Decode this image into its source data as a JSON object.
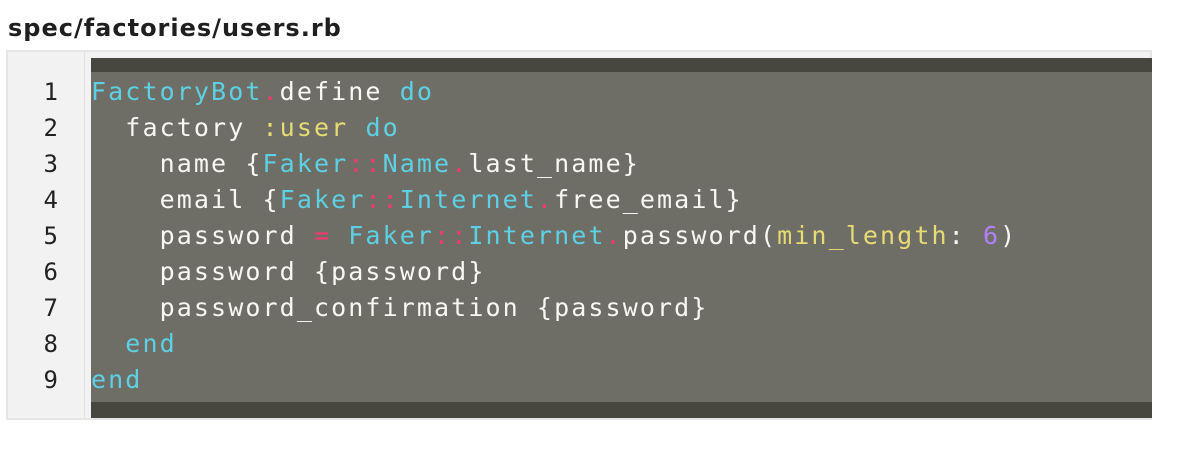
{
  "file_title": "spec/factories/users.rb",
  "line_numbers": [
    "1",
    "2",
    "3",
    "4",
    "5",
    "6",
    "7",
    "8",
    "9"
  ],
  "colors": {
    "keyword": "#5dd1e3",
    "operator": "#f2386f",
    "symbol": "#e6db74",
    "number": "#ae81ff",
    "text": "#f8f8f2",
    "code_background": "#6f6e66"
  },
  "code_lines": [
    [
      {
        "text": "FactoryBot",
        "type": "const"
      },
      {
        "text": ".",
        "type": "op"
      },
      {
        "text": "define ",
        "type": "plain"
      },
      {
        "text": "do",
        "type": "kw"
      }
    ],
    [
      {
        "text": "  factory ",
        "type": "plain"
      },
      {
        "text": ":user ",
        "type": "sym"
      },
      {
        "text": "do",
        "type": "kw"
      }
    ],
    [
      {
        "text": "    name {",
        "type": "plain"
      },
      {
        "text": "Faker",
        "type": "const"
      },
      {
        "text": "::",
        "type": "op"
      },
      {
        "text": "Name",
        "type": "const"
      },
      {
        "text": ".",
        "type": "op"
      },
      {
        "text": "last_name}",
        "type": "plain"
      }
    ],
    [
      {
        "text": "    email {",
        "type": "plain"
      },
      {
        "text": "Faker",
        "type": "const"
      },
      {
        "text": "::",
        "type": "op"
      },
      {
        "text": "Internet",
        "type": "const"
      },
      {
        "text": ".",
        "type": "op"
      },
      {
        "text": "free_email}",
        "type": "plain"
      }
    ],
    [
      {
        "text": "    password ",
        "type": "plain"
      },
      {
        "text": "=",
        "type": "op"
      },
      {
        "text": " ",
        "type": "plain"
      },
      {
        "text": "Faker",
        "type": "const"
      },
      {
        "text": "::",
        "type": "op"
      },
      {
        "text": "Internet",
        "type": "const"
      },
      {
        "text": ".",
        "type": "op"
      },
      {
        "text": "password(",
        "type": "plain"
      },
      {
        "text": "min_length",
        "type": "sym"
      },
      {
        "text": ": ",
        "type": "plain"
      },
      {
        "text": "6",
        "type": "num"
      },
      {
        "text": ")",
        "type": "plain"
      }
    ],
    [
      {
        "text": "    password {password}",
        "type": "plain"
      }
    ],
    [
      {
        "text": "    password_confirmation {password}",
        "type": "plain"
      }
    ],
    [
      {
        "text": "  end",
        "type": "kw"
      }
    ],
    [
      {
        "text": "end",
        "type": "kw"
      }
    ]
  ]
}
